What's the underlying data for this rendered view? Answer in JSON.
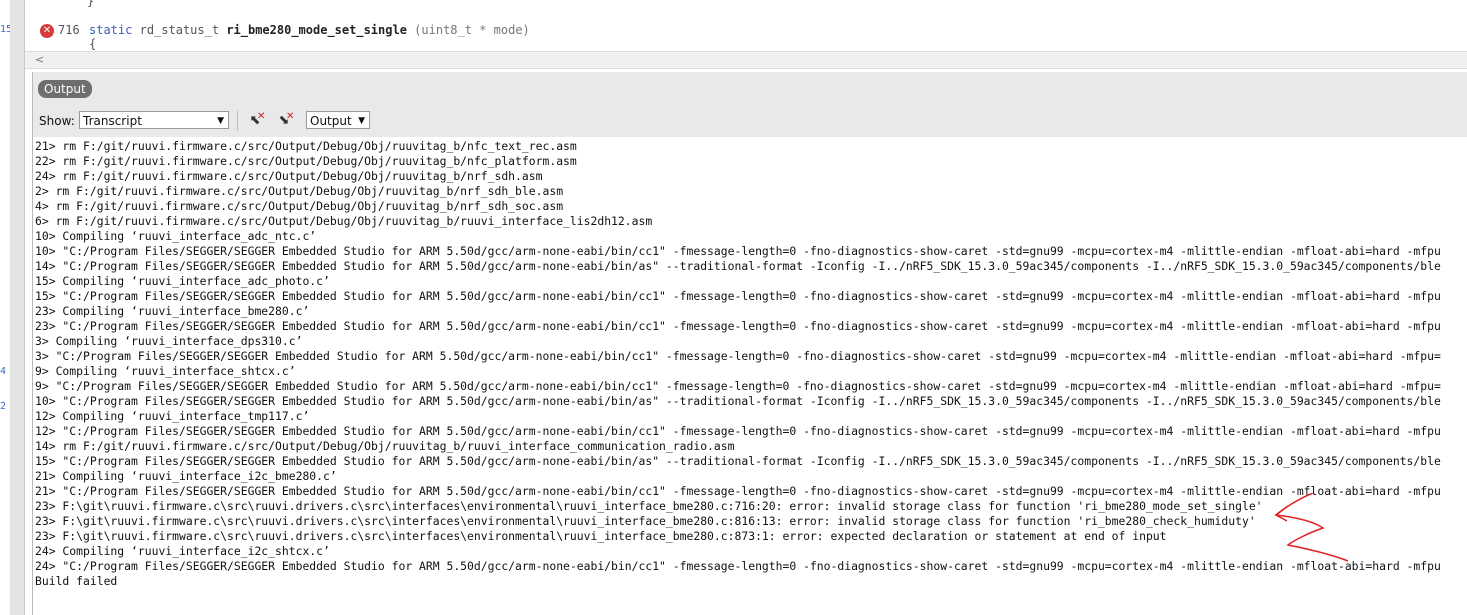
{
  "gutter_numbers": [
    "15",
    "4",
    "2"
  ],
  "editor": {
    "line_above": "}",
    "line_number": "716",
    "code": {
      "keyword": "static",
      "type": "rd_status_t",
      "function": "ri_bme280_mode_set_single",
      "params": "(uint8_t * mode)"
    },
    "brace": "{",
    "scroll_left_glyph": "<"
  },
  "output_panel": {
    "title": "Output",
    "show_label": "Show:",
    "show_value": "Transcript",
    "target_value": "Output",
    "prev_error_glyph": "✕",
    "next_error_glyph": "✕",
    "dropdown_arrow": "▼"
  },
  "log_lines": [
    "21> rm F:/git/ruuvi.firmware.c/src/Output/Debug/Obj/ruuvitag_b/nfc_text_rec.asm",
    "22> rm F:/git/ruuvi.firmware.c/src/Output/Debug/Obj/ruuvitag_b/nfc_platform.asm",
    "24> rm F:/git/ruuvi.firmware.c/src/Output/Debug/Obj/ruuvitag_b/nrf_sdh.asm",
    "2> rm F:/git/ruuvi.firmware.c/src/Output/Debug/Obj/ruuvitag_b/nrf_sdh_ble.asm",
    "4> rm F:/git/ruuvi.firmware.c/src/Output/Debug/Obj/ruuvitag_b/nrf_sdh_soc.asm",
    "6> rm F:/git/ruuvi.firmware.c/src/Output/Debug/Obj/ruuvitag_b/ruuvi_interface_lis2dh12.asm",
    "10> Compiling ‘ruuvi_interface_adc_ntc.c’",
    "10> \"C:/Program Files/SEGGER/SEGGER Embedded Studio for ARM 5.50d/gcc/arm-none-eabi/bin/cc1\" -fmessage-length=0 -fno-diagnostics-show-caret -std=gnu99 -mcpu=cortex-m4 -mlittle-endian -mfloat-abi=hard -mfpu",
    "14> \"C:/Program Files/SEGGER/SEGGER Embedded Studio for ARM 5.50d/gcc/arm-none-eabi/bin/as\" --traditional-format -Iconfig -I../nRF5_SDK_15.3.0_59ac345/components -I../nRF5_SDK_15.3.0_59ac345/components/ble",
    "15> Compiling ‘ruuvi_interface_adc_photo.c’",
    "15> \"C:/Program Files/SEGGER/SEGGER Embedded Studio for ARM 5.50d/gcc/arm-none-eabi/bin/cc1\" -fmessage-length=0 -fno-diagnostics-show-caret -std=gnu99 -mcpu=cortex-m4 -mlittle-endian -mfloat-abi=hard -mfpu",
    "23> Compiling ‘ruuvi_interface_bme280.c’",
    "23> \"C:/Program Files/SEGGER/SEGGER Embedded Studio for ARM 5.50d/gcc/arm-none-eabi/bin/cc1\" -fmessage-length=0 -fno-diagnostics-show-caret -std=gnu99 -mcpu=cortex-m4 -mlittle-endian -mfloat-abi=hard -mfpu",
    "3> Compiling ‘ruuvi_interface_dps310.c’",
    "3> \"C:/Program Files/SEGGER/SEGGER Embedded Studio for ARM 5.50d/gcc/arm-none-eabi/bin/cc1\" -fmessage-length=0 -fno-diagnostics-show-caret -std=gnu99 -mcpu=cortex-m4 -mlittle-endian -mfloat-abi=hard -mfpu=",
    "9> Compiling ‘ruuvi_interface_shtcx.c’",
    "9> \"C:/Program Files/SEGGER/SEGGER Embedded Studio for ARM 5.50d/gcc/arm-none-eabi/bin/cc1\" -fmessage-length=0 -fno-diagnostics-show-caret -std=gnu99 -mcpu=cortex-m4 -mlittle-endian -mfloat-abi=hard -mfpu=",
    "10> \"C:/Program Files/SEGGER/SEGGER Embedded Studio for ARM 5.50d/gcc/arm-none-eabi/bin/as\" --traditional-format -Iconfig -I../nRF5_SDK_15.3.0_59ac345/components -I../nRF5_SDK_15.3.0_59ac345/components/ble",
    "12> Compiling ‘ruuvi_interface_tmp117.c’",
    "12> \"C:/Program Files/SEGGER/SEGGER Embedded Studio for ARM 5.50d/gcc/arm-none-eabi/bin/cc1\" -fmessage-length=0 -fno-diagnostics-show-caret -std=gnu99 -mcpu=cortex-m4 -mlittle-endian -mfloat-abi=hard -mfpu",
    "14> rm F:/git/ruuvi.firmware.c/src/Output/Debug/Obj/ruuvitag_b/ruuvi_interface_communication_radio.asm",
    "15> \"C:/Program Files/SEGGER/SEGGER Embedded Studio for ARM 5.50d/gcc/arm-none-eabi/bin/as\" --traditional-format -Iconfig -I../nRF5_SDK_15.3.0_59ac345/components -I../nRF5_SDK_15.3.0_59ac345/components/ble",
    "21> Compiling ‘ruuvi_interface_i2c_bme280.c’",
    "21> \"C:/Program Files/SEGGER/SEGGER Embedded Studio for ARM 5.50d/gcc/arm-none-eabi/bin/cc1\" -fmessage-length=0 -fno-diagnostics-show-caret -std=gnu99 -mcpu=cortex-m4 -mlittle-endian -mfloat-abi=hard -mfpu",
    "23> F:\\git\\ruuvi.firmware.c\\src\\ruuvi.drivers.c\\src\\interfaces\\environmental\\ruuvi_interface_bme280.c:716:20: error: invalid storage class for function 'ri_bme280_mode_set_single'",
    "23> F:\\git\\ruuvi.firmware.c\\src\\ruuvi.drivers.c\\src\\interfaces\\environmental\\ruuvi_interface_bme280.c:816:13: error: invalid storage class for function 'ri_bme280_check_humiduty'",
    "23> F:\\git\\ruuvi.firmware.c\\src\\ruuvi.drivers.c\\src\\interfaces\\environmental\\ruuvi_interface_bme280.c:873:1: error: expected declaration or statement at end of input",
    "24> Compiling ‘ruuvi_interface_i2c_shtcx.c’",
    "24> \"C:/Program Files/SEGGER/SEGGER Embedded Studio for ARM 5.50d/gcc/arm-none-eabi/bin/cc1\" -fmessage-length=0 -fno-diagnostics-show-caret -std=gnu99 -mcpu=cortex-m4 -mlittle-endian -mfloat-abi=hard -mfpu",
    "Build failed"
  ],
  "colors": {
    "annotation_red": "#e02020",
    "error_icon_red": "#d63a3a",
    "keyword_blue": "#3b5fb5"
  }
}
